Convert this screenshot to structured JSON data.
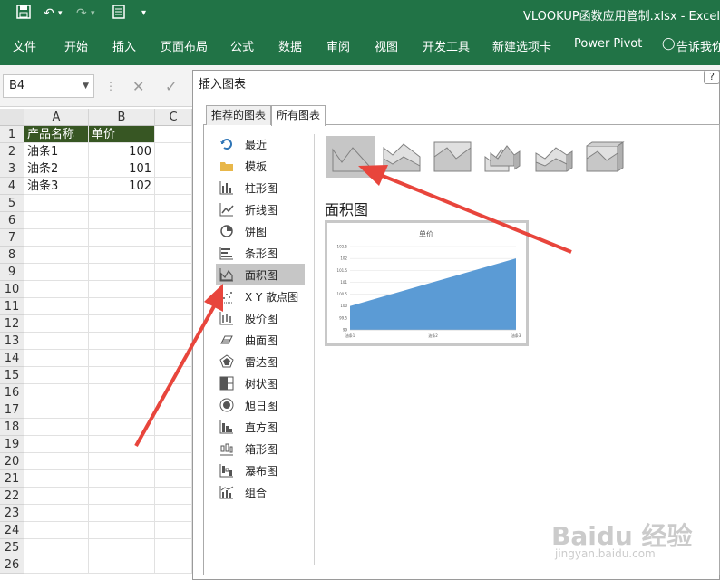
{
  "window": {
    "title": "VLOOKUP函数应用管制.xlsx  -  Excel"
  },
  "quick_access": {
    "icons": [
      "save-icon",
      "undo-icon",
      "redo-icon",
      "form-icon",
      "customize-icon"
    ]
  },
  "ribbon": {
    "tabs": [
      "文件",
      "开始",
      "插入",
      "页面布局",
      "公式",
      "数据",
      "审阅",
      "视图",
      "开发工具",
      "新建选项卡",
      "Power Pivot"
    ],
    "tell_me": "告诉我你"
  },
  "formula_bar": {
    "name_box": "B4",
    "cancel_glyph": "✕",
    "enter_glyph": "✓"
  },
  "sheet": {
    "columns": [
      "A",
      "B",
      "C"
    ],
    "rows": [
      "1",
      "2",
      "3",
      "4",
      "5",
      "6",
      "7",
      "8",
      "9",
      "10",
      "11",
      "12",
      "13",
      "14",
      "15",
      "16",
      "17",
      "18",
      "19",
      "20",
      "21",
      "22",
      "23",
      "24",
      "25",
      "26"
    ],
    "header_cells": [
      "产品名称",
      "单价"
    ],
    "data_rows": [
      {
        "name": "油条1",
        "price": "100"
      },
      {
        "name": "油条2",
        "price": "101"
      },
      {
        "name": "油条3",
        "price": "102"
      }
    ]
  },
  "dialog": {
    "title": "插入图表",
    "help": "?",
    "tabs": [
      "推荐的图表",
      "所有图表"
    ],
    "active_tab": "所有图表",
    "categories": [
      "最近",
      "模板",
      "柱形图",
      "折线图",
      "饼图",
      "条形图",
      "面积图",
      "X Y 散点图",
      "股价图",
      "曲面图",
      "雷达图",
      "树状图",
      "旭日图",
      "直方图",
      "箱形图",
      "瀑布图",
      "组合"
    ],
    "selected_category": "面积图",
    "chart_type_title": "面积图",
    "preview": {
      "title": "单价",
      "y_ticks": [
        "102.5",
        "102",
        "101.5",
        "101",
        "100.5",
        "100",
        "99.5",
        "99"
      ],
      "x_ticks": [
        "油条1",
        "油条2",
        "油条3"
      ]
    }
  },
  "chart_data": {
    "type": "area",
    "title": "单价",
    "categories": [
      "油条1",
      "油条2",
      "油条3"
    ],
    "series": [
      {
        "name": "单价",
        "values": [
          100,
          101,
          102
        ]
      }
    ],
    "ylim": [
      99,
      102.5
    ],
    "color": "#5b9bd5"
  },
  "watermark": {
    "logo": "Baidu 经验",
    "url": "jingyan.baidu.com"
  },
  "colors": {
    "excel_green": "#217346",
    "header_fill": "#375623",
    "arrow": "#e8453c",
    "area_fill": "#5b9bd5"
  }
}
